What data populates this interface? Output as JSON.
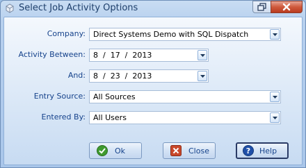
{
  "window": {
    "title": "Select Job Activity Options"
  },
  "form": {
    "company_label": "Company:",
    "company_value": "Direct Systems Demo with SQL Dispatch",
    "activity_between_label": "Activity Between:",
    "activity_start": "8  /  17  /  2013",
    "and_label": "And:",
    "activity_end": "8  /  23  /  2013",
    "entry_source_label": "Entry Source:",
    "entry_source_value": "All Sources",
    "entered_by_label": "Entered By:",
    "entered_by_value": "All Users"
  },
  "buttons": {
    "ok": "Ok",
    "close": "Close",
    "help": "Help"
  },
  "colors": {
    "accent": "#15428b",
    "close_red": "#c9482b",
    "ok_green": "#3f9a2f",
    "help_blue": "#1f4fa8"
  }
}
